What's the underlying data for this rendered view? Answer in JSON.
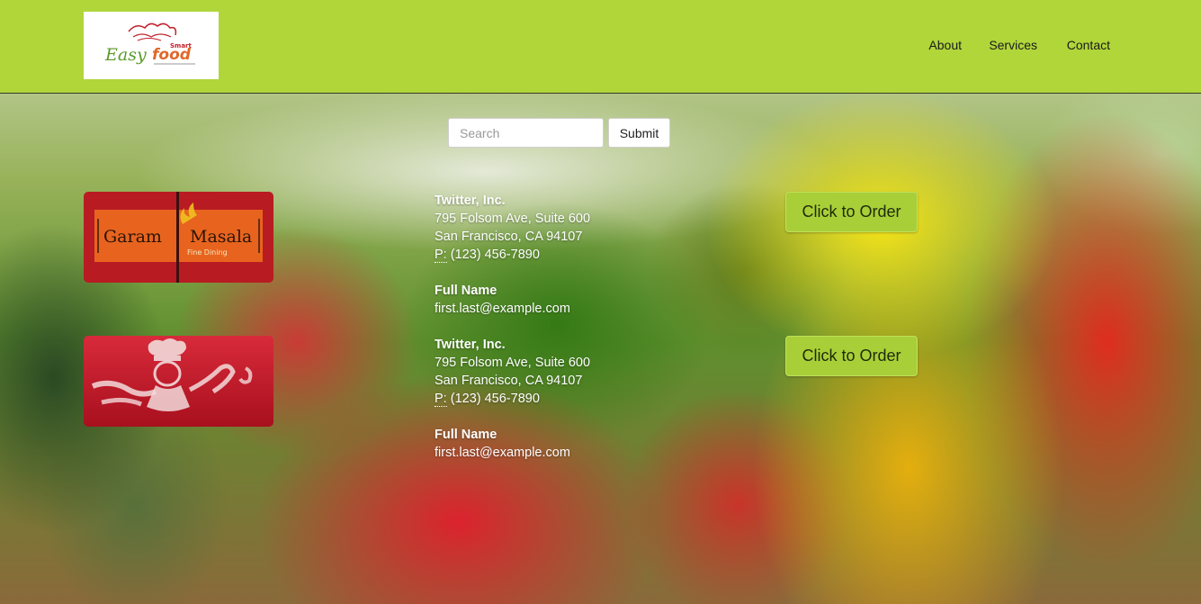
{
  "brand": {
    "logo_text_1": "Easy",
    "logo_text_2": "food",
    "logo_text_3": "Smart"
  },
  "nav": {
    "items": [
      {
        "label": "About"
      },
      {
        "label": "Services"
      },
      {
        "label": "Contact"
      }
    ]
  },
  "search": {
    "placeholder": "Search",
    "value": "",
    "submit_label": "Submit"
  },
  "restaurants": [
    {
      "logo": {
        "title_left": "Garam",
        "title_right": "Masala",
        "subtitle": "Fine Dining"
      },
      "company": "Twitter, Inc.",
      "street": "795 Folsom Ave, Suite 600",
      "city": "San Francisco, CA 94107",
      "phone_label": "P:",
      "phone": "(123) 456-7890",
      "contact_name": "Full Name",
      "email": "first.last@example.com",
      "order_label": "Click to Order"
    },
    {
      "company": "Twitter, Inc.",
      "street": "795 Folsom Ave, Suite 600",
      "city": "San Francisco, CA 94107",
      "phone_label": "P:",
      "phone": "(123) 456-7890",
      "contact_name": "Full Name",
      "email": "first.last@example.com",
      "order_label": "Click to Order"
    }
  ],
  "colors": {
    "header_bg": "#b0d63a",
    "order_button_bg": "#a9cf38",
    "garam_masala_red": "#b81c22",
    "garam_masala_orange": "#e8641e"
  }
}
